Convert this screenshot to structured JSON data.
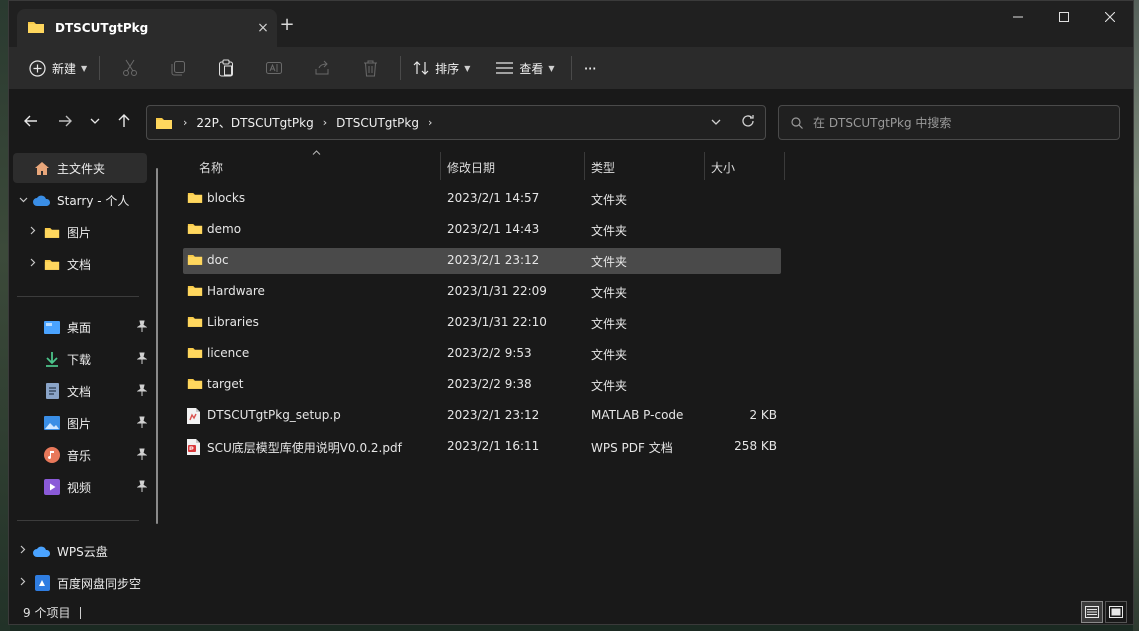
{
  "window": {
    "tab_title": "DTSCUTgtPkg",
    "tab_close": "×",
    "new_tab": "+"
  },
  "toolbar": {
    "new_label": "新建",
    "sort_label": "排序",
    "view_label": "查看",
    "more": "···"
  },
  "address": {
    "crumbs": [
      "22P、DTSCUTgtPkg",
      "DTSCUTgtPkg"
    ],
    "separator": "›"
  },
  "search": {
    "placeholder": "在 DTSCUTgtPkg 中搜索"
  },
  "sidebar": {
    "home": "主文件夹",
    "onedrive": "Starry - 个人",
    "pictures_top": "图片",
    "docs_top": "文档",
    "desktop": "桌面",
    "downloads": "下载",
    "documents": "文档",
    "pictures": "图片",
    "music": "音乐",
    "videos": "视频",
    "wps": "WPS云盘",
    "baidu": "百度网盘同步空"
  },
  "columns": {
    "name": "名称",
    "modified": "修改日期",
    "type": "类型",
    "size": "大小"
  },
  "files": [
    {
      "name": "blocks",
      "modified": "2023/2/1 14:57",
      "type": "文件夹",
      "size": ""
    },
    {
      "name": "demo",
      "modified": "2023/2/1 14:43",
      "type": "文件夹",
      "size": ""
    },
    {
      "name": "doc",
      "modified": "2023/2/1 23:12",
      "type": "文件夹",
      "size": ""
    },
    {
      "name": "Hardware",
      "modified": "2023/1/31 22:09",
      "type": "文件夹",
      "size": ""
    },
    {
      "name": "Libraries",
      "modified": "2023/1/31 22:10",
      "type": "文件夹",
      "size": ""
    },
    {
      "name": "licence",
      "modified": "2023/2/2 9:53",
      "type": "文件夹",
      "size": ""
    },
    {
      "name": "target",
      "modified": "2023/2/2 9:38",
      "type": "文件夹",
      "size": ""
    },
    {
      "name": "DTSCUTgtPkg_setup.p",
      "modified": "2023/2/1 23:12",
      "type": "MATLAB P-code",
      "size": "2 KB"
    },
    {
      "name": "SCU底层模型库使用说明V0.0.2.pdf",
      "modified": "2023/2/1 16:11",
      "type": "WPS PDF 文档",
      "size": "258 KB"
    }
  ],
  "status": {
    "count": "9 个项目"
  },
  "colors": {
    "folder": "#f7c948",
    "accent": "#4aa3ff",
    "selected_row": "#4a4a4a"
  }
}
